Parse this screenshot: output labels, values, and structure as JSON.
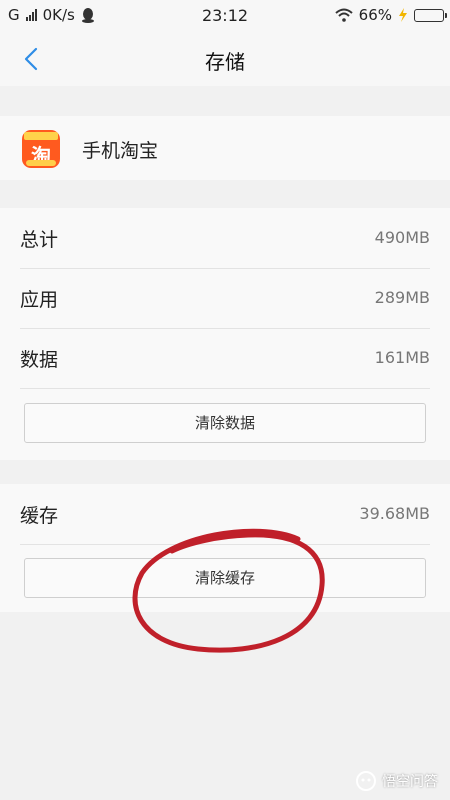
{
  "status_bar": {
    "carrier": "G",
    "speed": "0K/s",
    "time": "23:12",
    "battery": "66%",
    "battery_level": 0.66
  },
  "nav": {
    "title": "存储",
    "back_icon": "chevron-left-icon"
  },
  "app": {
    "name": "手机淘宝",
    "icon_glyph": "淘",
    "icon_color": "#ff5a1f"
  },
  "storage": {
    "rows": [
      {
        "label": "总计",
        "value": "490MB"
      },
      {
        "label": "应用",
        "value": "289MB"
      },
      {
        "label": "数据",
        "value": "161MB"
      }
    ],
    "clear_data_label": "清除数据"
  },
  "cache": {
    "label": "缓存",
    "value": "39.68MB",
    "clear_cache_label": "清除缓存"
  },
  "annotation": {
    "circle_color": "#c0202a"
  },
  "watermark": {
    "text": "悟空问答"
  }
}
